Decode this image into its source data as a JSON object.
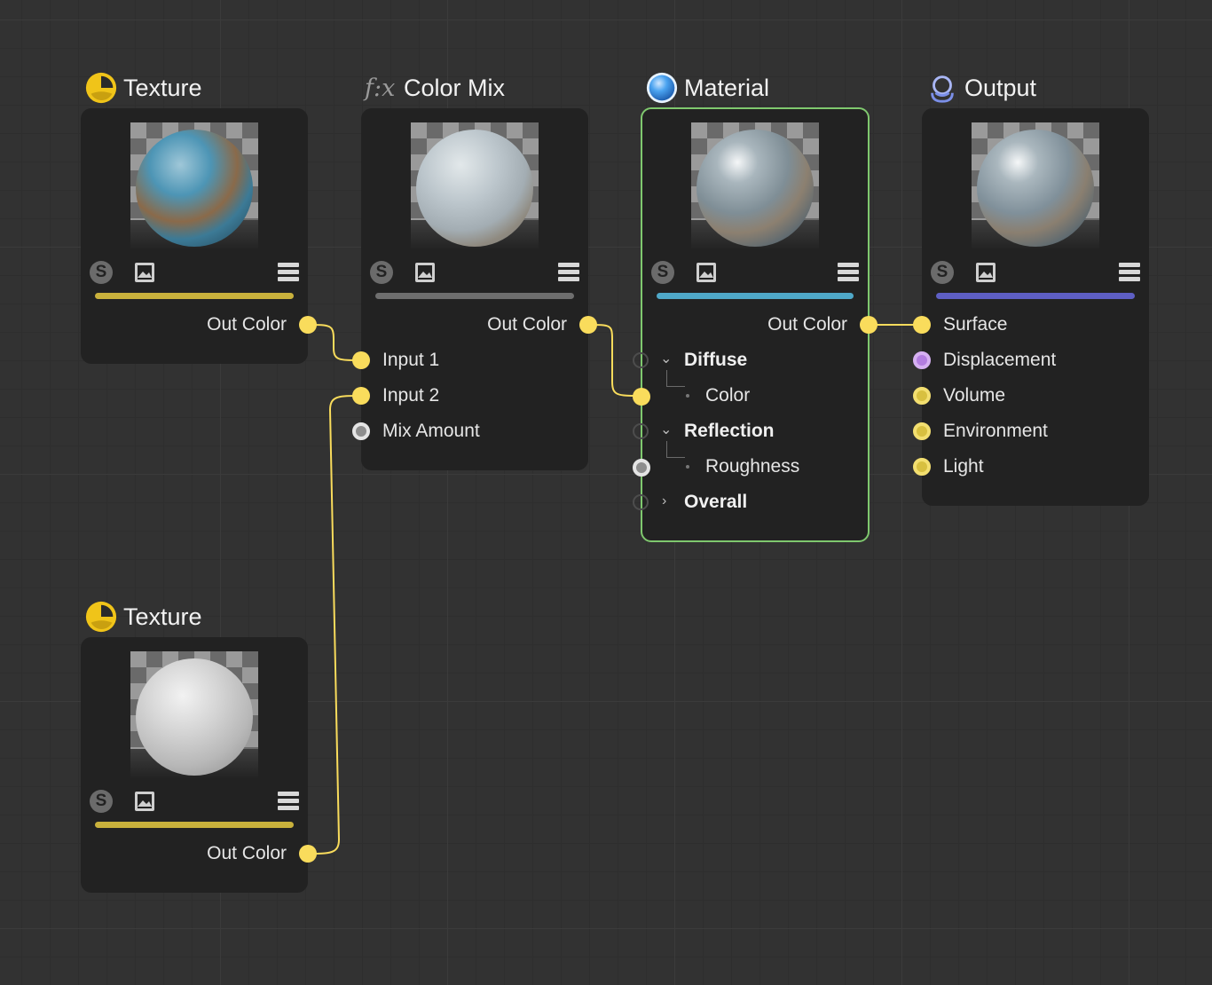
{
  "colors": {
    "background": "#323232",
    "node_body": "#222222",
    "wire": "#f9dc5c",
    "texture_bar": "#c9b13c",
    "mix_bar": "#6e6e6e",
    "material_bar": "#4fa8c8",
    "output_bar": "#5e5fc4",
    "selected_border": "#7fc86e"
  },
  "nodes": {
    "texture1": {
      "title": "Texture",
      "icon": "texture-icon",
      "out_port": "Out Color"
    },
    "color_mix": {
      "title": "Color Mix",
      "icon": "function-fx-icon",
      "icon_text": "f:x",
      "out_port": "Out Color",
      "inputs": [
        "Input 1",
        "Input 2",
        "Mix Amount"
      ]
    },
    "material": {
      "title": "Material",
      "icon": "material-sphere-icon",
      "out_port": "Out Color",
      "sections": {
        "diffuse": "Diffuse",
        "diffuse_color": "Color",
        "reflection": "Reflection",
        "roughness": "Roughness",
        "overall": "Overall"
      }
    },
    "output": {
      "title": "Output",
      "icon": "output-icon",
      "inputs": [
        "Surface",
        "Displacement",
        "Volume",
        "Environment",
        "Light"
      ]
    },
    "texture2": {
      "title": "Texture",
      "icon": "texture-icon",
      "out_port": "Out Color"
    }
  },
  "toolbar": {
    "solo_label": "S",
    "solo_icon": "solo-icon",
    "image_icon": "image-icon",
    "menu_icon": "menu-icon"
  }
}
